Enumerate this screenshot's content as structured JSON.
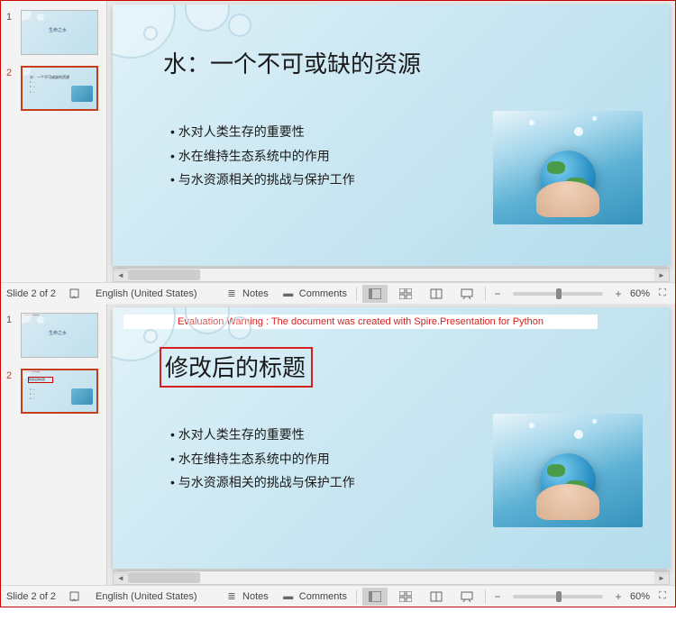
{
  "top": {
    "slide": {
      "title": "水：一个不可或缺的资源",
      "bullets": [
        "水对人类生存的重要性",
        "水在维持生态系统中的作用",
        "与水资源相关的挑战与保护工作"
      ]
    },
    "thumbs": [
      {
        "num": "1"
      },
      {
        "num": "2"
      }
    ],
    "status": {
      "slide_info": "Slide 2 of 2",
      "language": "English (United States)",
      "notes_label": "Notes",
      "comments_label": "Comments",
      "zoom_pct": "60%"
    }
  },
  "bottom": {
    "warning": "Evaluation Warning : The document was created with Spire.Presentation for Python",
    "slide": {
      "title": "修改后的标题",
      "bullets": [
        "水对人类生存的重要性",
        "水在维持生态系统中的作用",
        "与水资源相关的挑战与保护工作"
      ]
    },
    "thumbs": [
      {
        "num": "1"
      },
      {
        "num": "2"
      }
    ],
    "status": {
      "slide_info": "Slide 2 of 2",
      "language": "English (United States)",
      "notes_label": "Notes",
      "comments_label": "Comments",
      "zoom_pct": "60%"
    }
  },
  "icons": {
    "notes": "≣",
    "comments": "▬",
    "minus": "−",
    "plus": "+",
    "fit": "⛶",
    "left": "◄",
    "right": "►"
  }
}
